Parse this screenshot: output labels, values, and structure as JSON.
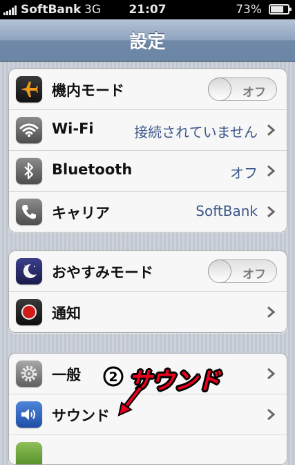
{
  "status_bar": {
    "carrier": "SoftBank",
    "network": "3G",
    "time": "21:07",
    "battery_text": "73%",
    "battery_level": 0.73
  },
  "nav": {
    "title": "設定"
  },
  "groups": [
    {
      "rows": [
        {
          "label": "機内モード",
          "icon": "airplane-icon",
          "toggle": "オフ"
        },
        {
          "label": "Wi-Fi",
          "icon": "wifi-icon",
          "value": "接続されていません"
        },
        {
          "label": "Bluetooth",
          "icon": "bluetooth-icon",
          "value": "オフ"
        },
        {
          "label": "キャリア",
          "icon": "phone-icon",
          "value": "SoftBank"
        }
      ]
    },
    {
      "rows": [
        {
          "label": "おやすみモード",
          "icon": "moon-icon",
          "toggle": "オフ"
        },
        {
          "label": "通知",
          "icon": "notification-icon"
        }
      ]
    },
    {
      "rows": [
        {
          "label": "一般",
          "icon": "gear-icon"
        },
        {
          "label": "サウンド",
          "icon": "speaker-icon"
        }
      ]
    }
  ],
  "annotation": {
    "number": "2",
    "text": "サウンド",
    "color": "#e8001f"
  }
}
